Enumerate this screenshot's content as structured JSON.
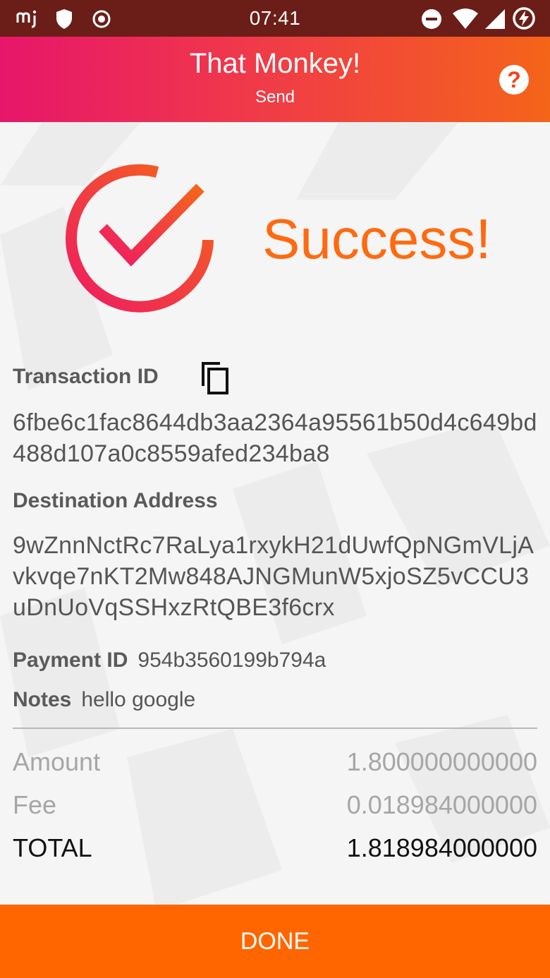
{
  "status_bar": {
    "time": "07:41",
    "left_icons": [
      "mj-app-icon",
      "shield-icon",
      "record-icon"
    ],
    "right_icons": [
      "do-not-disturb-icon",
      "wifi-icon",
      "signal-icon",
      "battery-charging-icon"
    ]
  },
  "app_bar": {
    "title": "That Monkey!",
    "subtitle": "Send",
    "help_label": "?"
  },
  "success": {
    "text": "Success!",
    "icon": "check-circle-icon"
  },
  "transaction": {
    "id_label": "Transaction ID",
    "id_value": "6fbe6c1fac8644db3aa2364a95561b50d4c649bd488d107a0c8559afed234ba8",
    "copy_icon": "copy-icon",
    "destination_label": "Destination Address",
    "destination_value": "9wZnnNctRc7RaLya1rxykH21dUwfQpNGmVLjAvkvqe7nKT2Mw848AJNGMunW5xjoSZ5vCCU3uDnUoVqSSHxzRtQBE3f6crx",
    "payment_id_label": "Payment ID",
    "payment_id_value": "954b3560199b794a",
    "notes_label": "Notes",
    "notes_value": "hello google"
  },
  "summary": {
    "amount_label": "Amount",
    "amount_value": "1.800000000000",
    "fee_label": "Fee",
    "fee_value": "0.018984000000",
    "total_label": "TOTAL",
    "total_value": "1.818984000000"
  },
  "done_button": {
    "label": "DONE"
  },
  "colors": {
    "accent": "#ff6600",
    "status_bar": "#6a1e17",
    "gradient_start": "#e7166a",
    "gradient_end": "#f46419"
  }
}
